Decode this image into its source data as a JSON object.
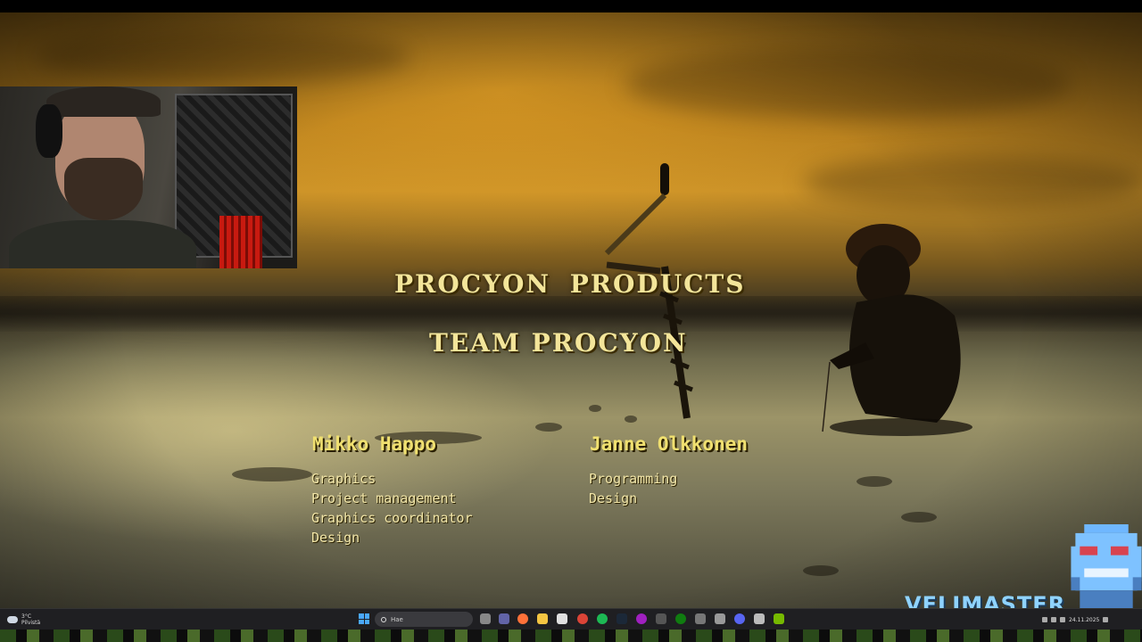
{
  "credits": {
    "title": "PROCYON PRODUCTS",
    "subtitle": "TEAM PROCYON",
    "people": [
      {
        "name": "Mikko Happo",
        "roles": [
          "Graphics",
          "Project management",
          "Graphics coordinator",
          "Design"
        ]
      },
      {
        "name": "Janne Olkkonen",
        "roles": [
          "Programming",
          "Design"
        ]
      }
    ]
  },
  "overlay": {
    "brand": "VELIMASTER"
  },
  "taskbar": {
    "weather": {
      "temp": "3°C",
      "condition": "Pilvistä"
    },
    "search_placeholder": "Hae",
    "clock": {
      "date": "24.11.2025"
    },
    "icons": [
      "task-view-icon",
      "teams-icon",
      "firefox-icon",
      "file-explorer-icon",
      "store-icon",
      "chrome-icon",
      "spotify-icon",
      "steam-icon",
      "obs-icon",
      "calculator-icon",
      "xbox-icon",
      "settings-icon",
      "game-icon",
      "discord-icon",
      "app-icon",
      "nvidia-icon"
    ]
  },
  "colors": {
    "credit_text": "#f0e070",
    "brand": "#8fd3ff",
    "taskbar": "#1f1f22"
  }
}
